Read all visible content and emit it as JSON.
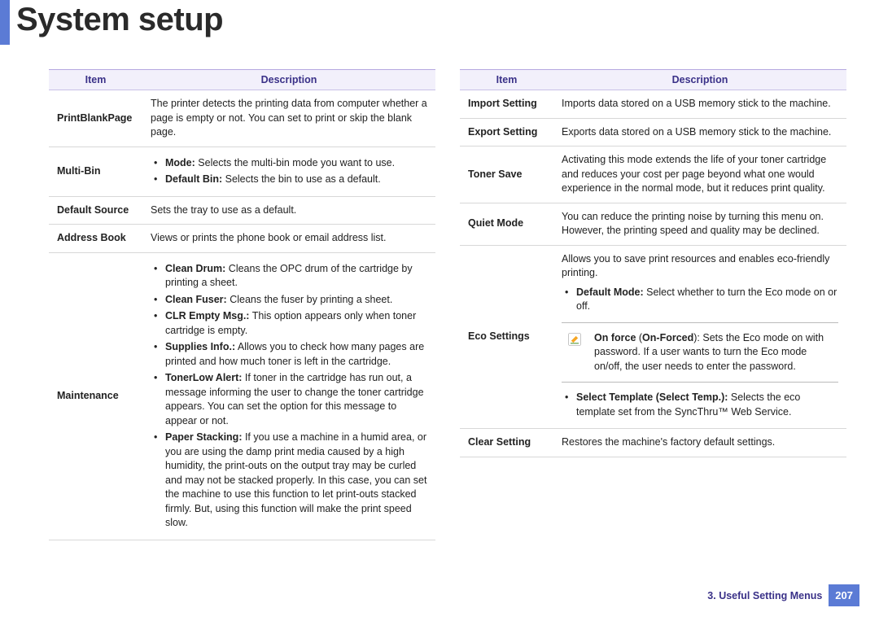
{
  "title": "System setup",
  "headers": {
    "item": "Item",
    "desc": "Description"
  },
  "left": {
    "printblank": {
      "name": "PrintBlankPage",
      "desc": "The printer detects the printing data from computer whether a page is empty or not. You can set to print or skip the blank page."
    },
    "multibin": {
      "name": "Multi-Bin",
      "b1_bold": "Mode:",
      "b1_text": " Selects the multi-bin mode you want to use.",
      "b2_bold": "Default Bin:",
      "b2_text": " Selects the bin to use as a default."
    },
    "defsource": {
      "name": "Default Source",
      "desc": "Sets the tray to use as a default."
    },
    "addrbook": {
      "name": "Address Book",
      "desc": "Views or prints the phone book or email address list."
    },
    "maint": {
      "name": "Maintenance",
      "b1_bold": "Clean Drum:",
      "b1_text": " Cleans the OPC drum of the cartridge by printing a sheet.",
      "b2_bold": "Clean Fuser:",
      "b2_text": " Cleans the fuser by printing a sheet.",
      "b3_bold": "CLR Empty Msg.:",
      "b3_text": "  This option appears only when toner cartridge is empty.",
      "b4_bold": "Supplies Info.:",
      "b4_text": " Allows you to check how many pages are printed and how much toner is left in the cartridge.",
      "b5_bold": "TonerLow Alert:",
      "b5_text": " If toner in the cartridge has run out, a message informing the user to change the toner cartridge appears. You can set the option for this message to appear or not.",
      "b6_bold": "Paper Stacking:",
      "b6_text": " If you use a machine in a humid area, or you are using the damp print media caused by a high humidity, the print-outs on the output tray may be curled and may not be stacked properly. In this case, you can set the machine to use this function to let print-outs stacked firmly. But, using this function will make the print speed slow."
    }
  },
  "right": {
    "importset": {
      "name": "Import Setting",
      "desc": "Imports data stored on a USB memory stick to the machine."
    },
    "exportset": {
      "name": "Export Setting",
      "desc": "Exports data stored on a USB memory stick to the machine."
    },
    "tonersave": {
      "name": "Toner Save",
      "desc": "Activating this mode extends the life of your toner cartridge and reduces your cost per page beyond what one would experience in the normal mode, but it reduces print quality."
    },
    "quiet": {
      "name": "Quiet Mode",
      "desc": "You can reduce the printing noise by turning this menu on. However, the printing speed and quality may be declined."
    },
    "eco": {
      "name": "Eco Settings",
      "intro": "Allows you to save print resources and enables eco-friendly printing.",
      "b1_bold": "Default Mode:",
      "b1_text": " Select whether to turn the Eco mode on or off.",
      "note_b1": "On force",
      "note_p1": " (",
      "note_b2": "On-Forced",
      "note_p2": "): Sets the Eco mode on with password. If a user wants to turn the Eco mode on/off, the user needs to enter the password.",
      "b2_bold": "Select Template (Select Temp.):",
      "b2_text": " Selects the eco template set from the SyncThru™ Web Service."
    },
    "clear": {
      "name": "Clear Setting",
      "desc": "Restores the machine's factory default settings."
    }
  },
  "footer": {
    "chapter": "3.  Useful Setting Menus",
    "page": "207"
  }
}
